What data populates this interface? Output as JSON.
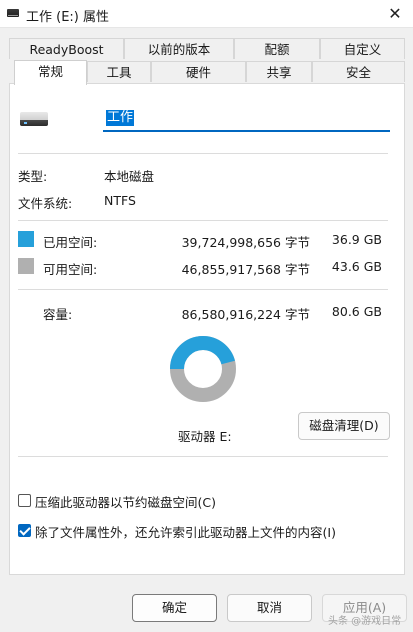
{
  "window": {
    "title": "工作 (E:) 属性",
    "close_glyph": "✕"
  },
  "tabs_top": [
    "ReadyBoost",
    "以前的版本",
    "配额",
    "自定义"
  ],
  "tabs_bottom": [
    "常规",
    "工具",
    "硬件",
    "共享",
    "安全"
  ],
  "active_tab": "常规",
  "drive": {
    "name": "工作"
  },
  "info": {
    "type_label": "类型:",
    "type_value": "本地磁盘",
    "fs_label": "文件系统:",
    "fs_value": "NTFS"
  },
  "space": {
    "used_label": "已用空间:",
    "used_bytes": "39,724,998,656 字节",
    "used_size": "36.9 GB",
    "free_label": "可用空间:",
    "free_bytes": "46,855,917,568 字节",
    "free_size": "43.6 GB",
    "capacity_label": "容量:",
    "capacity_bytes": "86,580,916,224 字节",
    "capacity_size": "80.6 GB",
    "used_color": "#26a0da",
    "free_color": "#b0b0b0",
    "used_fraction": 0.459
  },
  "drive_label": "驱动器 E:",
  "cleanup_button": "磁盘清理(D)",
  "options": {
    "compress_label": "压缩此驱动器以节约磁盘空间(C)",
    "compress_checked": false,
    "index_label": "除了文件属性外，还允许索引此驱动器上文件的内容(I)",
    "index_checked": true
  },
  "buttons": {
    "ok": "确定",
    "cancel": "取消",
    "apply": "应用(A)"
  },
  "watermark": "头条 @游戏日常"
}
